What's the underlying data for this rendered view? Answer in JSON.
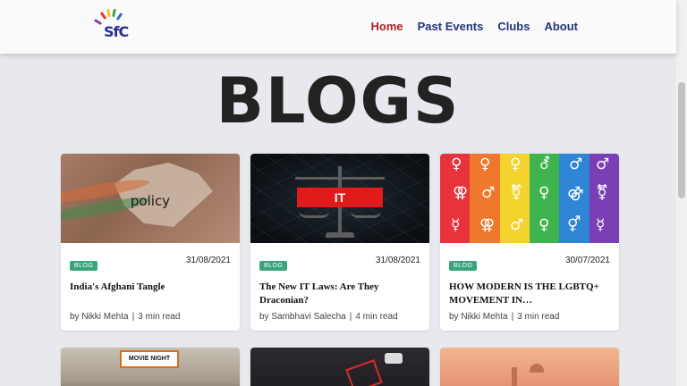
{
  "header": {
    "logo_text": "SfC",
    "nav": [
      {
        "label": "Home",
        "active": true
      },
      {
        "label": "Past Events",
        "active": false
      },
      {
        "label": "Clubs",
        "active": false
      },
      {
        "label": "About",
        "active": false
      }
    ]
  },
  "page_title": "BLOGS",
  "cards": [
    {
      "thumb_text": "policy",
      "badge": "BLOG",
      "date": "31/08/2021",
      "title": "India's Afghani Tangle",
      "author": "by Nikki Mehta",
      "read_time": "3 min read"
    },
    {
      "thumb_text": "IT",
      "badge": "BLOG",
      "date": "31/08/2021",
      "title": "The New IT Laws: Are They Draconian?",
      "author": "by Sambhavi Salecha",
      "read_time": "4 min read"
    },
    {
      "thumb_text": "",
      "badge": "BLOG",
      "date": "30/07/2021",
      "title": "HOW MODERN IS THE LGBTQ+ MOVEMENT IN…",
      "author": "by Nikki Mehta",
      "read_time": "3 min read"
    }
  ],
  "row2": {
    "movie_sign": "MOVIE NIGHT"
  },
  "colors": {
    "nav_text": "#23357a",
    "nav_active": "#b3202a",
    "badge": "#3aa57a",
    "background": "#e8e9ee"
  }
}
